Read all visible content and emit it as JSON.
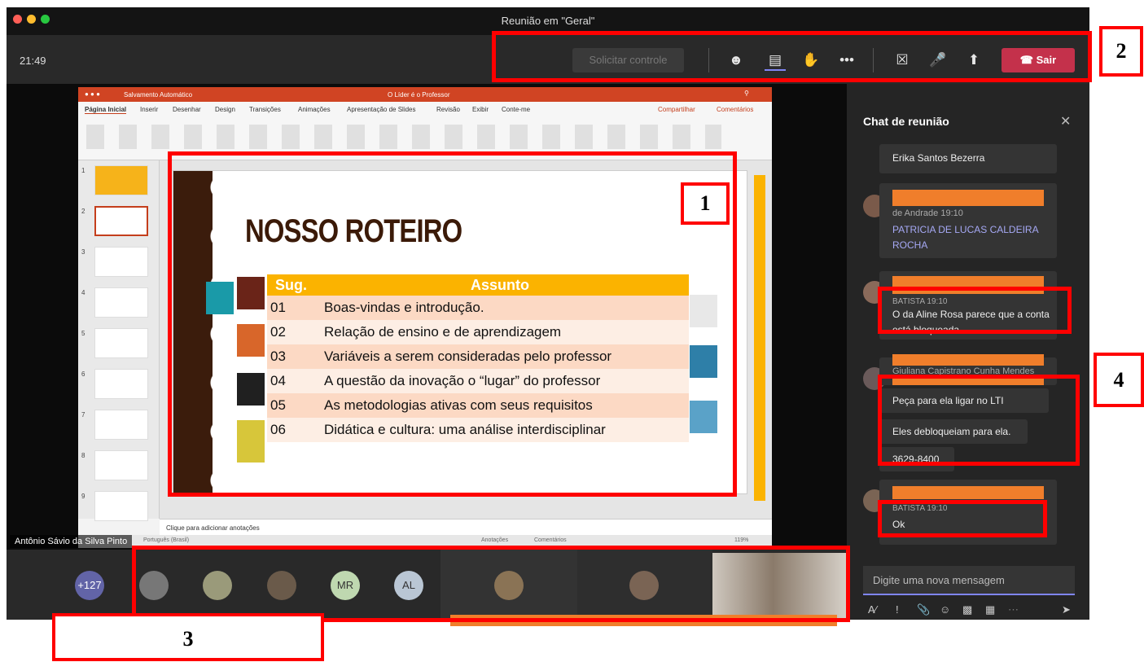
{
  "window": {
    "title": "Reunião em \"Geral\"",
    "clock": "21:49"
  },
  "toolbar": {
    "request_control": "Solicitar controle",
    "leave": "Sair"
  },
  "presenter_name": "Antônio Sávio da Silva Pinto",
  "powerpoint": {
    "autosave": "Salvamento Automático",
    "doc_title": "O Líder é o Professor",
    "tabs": [
      "Página Inicial",
      "Inserir",
      "Desenhar",
      "Design",
      "Transições",
      "Animações",
      "Apresentação de Slides",
      "Revisão",
      "Exibir",
      "Conte-me"
    ],
    "share": "Compartilhar",
    "comments": "Comentários",
    "notes": "Clique para adicionar anotações",
    "status_lang": "Português (Brasil)",
    "status_notes": "Anotações",
    "status_comments": "Comentários",
    "zoom": "119%",
    "thumb_numbers": [
      "1",
      "2",
      "3",
      "4",
      "5",
      "6",
      "7",
      "8",
      "9"
    ]
  },
  "slide": {
    "title": "NOSSO ROTEIRO",
    "col_sug": "Sug.",
    "col_subject": "Assunto",
    "rows": [
      {
        "sug": "01",
        "subject": "Boas-vindas e introdução."
      },
      {
        "sug": "02",
        "subject": "Relação de ensino e de aprendizagem"
      },
      {
        "sug": "03",
        "subject": "Variáveis a serem consideradas pelo professor"
      },
      {
        "sug": "04",
        "subject": "A questão da inovação o “lugar” do professor"
      },
      {
        "sug": "05",
        "subject": "As metodologias ativas com seus requisitos"
      },
      {
        "sug": "06",
        "subject": "Didática e cultura: uma análise interdisciplinar"
      }
    ]
  },
  "participants": {
    "overflow": "+127",
    "initials": [
      "MR",
      "AL"
    ]
  },
  "chat": {
    "title": "Chat de reunião",
    "messages": [
      {
        "text": "Erika Santos Bezerra"
      },
      {
        "meta": "de Andrade  19:10",
        "text": "PATRICIA DE LUCAS CALDEIRA ROCHA"
      },
      {
        "meta": "BATISTA  19:10",
        "text": "O da Aline Rosa parece que a conta está bloqueada"
      },
      {
        "meta": "Giuliana Capistrano Cunha Mendes",
        "texts": [
          "Peça para ela ligar no LTI",
          "Eles debloqueiam para ela.",
          "3629-8400"
        ]
      },
      {
        "meta": "BATISTA  19:10",
        "text": "Ok"
      }
    ],
    "input_placeholder": "Digite uma nova mensagem"
  },
  "annotations": [
    "1",
    "2",
    "3",
    "4"
  ],
  "colors": {
    "leave": "#c4314b",
    "annotation": "#ff0000",
    "highlight": "#f07e2b",
    "slide_header": "#fbb300"
  }
}
